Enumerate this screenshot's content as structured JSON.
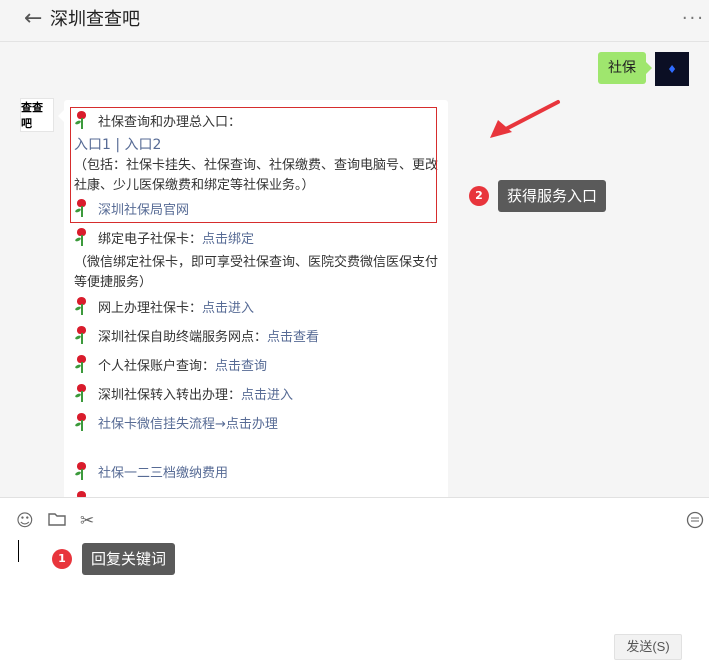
{
  "header": {
    "title": "深圳查查吧",
    "back_icon": "←",
    "more_icon": "···"
  },
  "chat": {
    "outgoing": {
      "text": "社保"
    },
    "incoming": {
      "avatar_text": "查查吧",
      "lines": [
        {
          "label": "社保查询和办理总入口："
        },
        {
          "link1": "入口1",
          "sep": "|",
          "link2": "入口2"
        },
        {
          "text": "（包括：社保卡挂失、社保查询、社保缴费、查询电脑号、更改社康、少儿医保缴费和绑定等社保业务。）"
        },
        {
          "link": "深圳社保局官网"
        },
        {
          "label": "绑定电子社保卡：",
          "link": "点击绑定"
        },
        {
          "text": "（微信绑定社保卡，即可享受社保查询、医院交费微信医保支付等便捷服务）"
        },
        {
          "label": "网上办理社保卡：",
          "link": "点击进入"
        },
        {
          "label": "深圳社保自助终端服务网点：",
          "link": "点击查看"
        },
        {
          "label": "个人社保账户查询：",
          "link": "点击查询"
        },
        {
          "label": "深圳社保转入转出办理：",
          "link": "点击进入"
        },
        {
          "link": "社保卡微信挂失流程→点击办理"
        },
        {
          "link": "社保一二三档缴纳费用"
        }
      ]
    }
  },
  "annotations": {
    "callout1": {
      "number": "1",
      "text": "回复关键词"
    },
    "callout2": {
      "number": "2",
      "text": "获得服务入口"
    }
  },
  "input": {
    "send_label": "发送(S)",
    "tools": [
      "emoji-icon",
      "folder-icon",
      "scissors-icon",
      "chat-history-icon"
    ]
  },
  "colors": {
    "link": "#576b95",
    "bubble_green": "#9fe66e",
    "highlight_red": "#d62d2d",
    "badge_red": "#e8353c"
  }
}
